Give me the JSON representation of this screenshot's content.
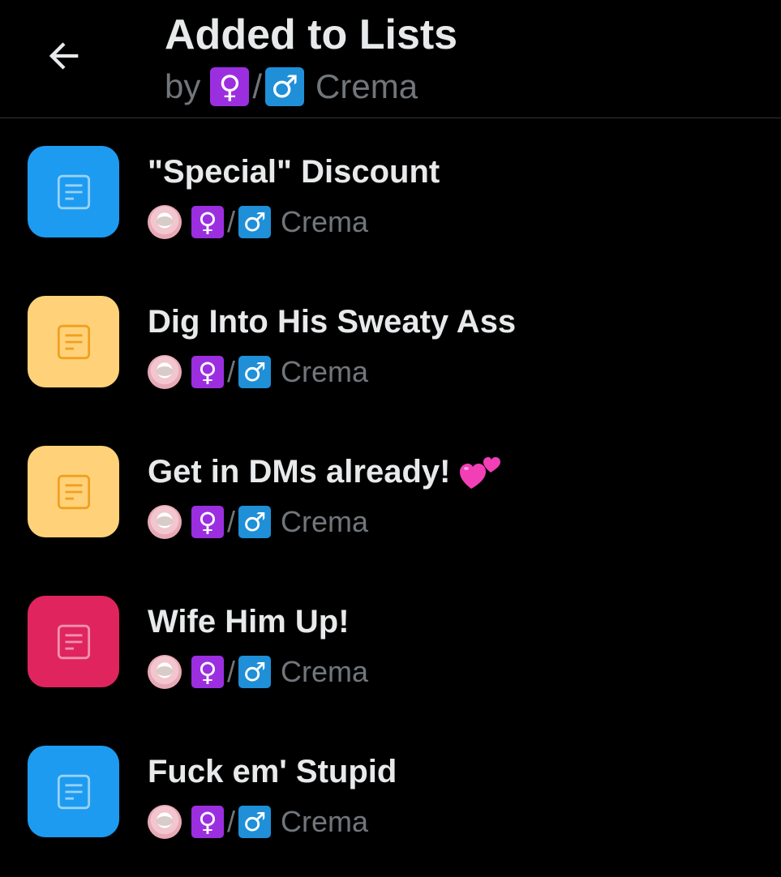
{
  "header": {
    "title": "Added to Lists",
    "by_label": "by",
    "owner_female_symbol": "♀",
    "owner_separator": "/",
    "owner_male_symbol": "♂",
    "owner_name": "Crema",
    "back_icon": "arrow-left-icon"
  },
  "colors": {
    "background": "#000000",
    "blue_tile": "#1d9bf0",
    "yellow_tile": "#ffd27a",
    "red_tile": "#e0245e"
  },
  "lists": [
    {
      "name": "\"Special\" Discount",
      "tile_color": "#1d9bf0",
      "icon": "document-icon",
      "owner_female": "♀",
      "owner_sep": "/",
      "owner_male": "♂",
      "owner_name": "Crema"
    },
    {
      "name": "Dig Into His Sweaty Ass",
      "tile_color": "#ffd27a",
      "icon": "document-icon",
      "owner_female": "♀",
      "owner_sep": "/",
      "owner_male": "♂",
      "owner_name": "Crema"
    },
    {
      "name": "Get in DMs already!",
      "emoji": "two-hearts-icon",
      "tile_color": "#ffd27a",
      "icon": "document-icon",
      "owner_female": "♀",
      "owner_sep": "/",
      "owner_male": "♂",
      "owner_name": "Crema"
    },
    {
      "name": "Wife Him Up!",
      "tile_color": "#e0245e",
      "icon": "document-icon",
      "owner_female": "♀",
      "owner_sep": "/",
      "owner_male": "♂",
      "owner_name": "Crema"
    },
    {
      "name": "Fuck em' Stupid",
      "tile_color": "#1d9bf0",
      "icon": "document-icon",
      "owner_female": "♀",
      "owner_sep": "/",
      "owner_male": "♂",
      "owner_name": "Crema"
    }
  ]
}
